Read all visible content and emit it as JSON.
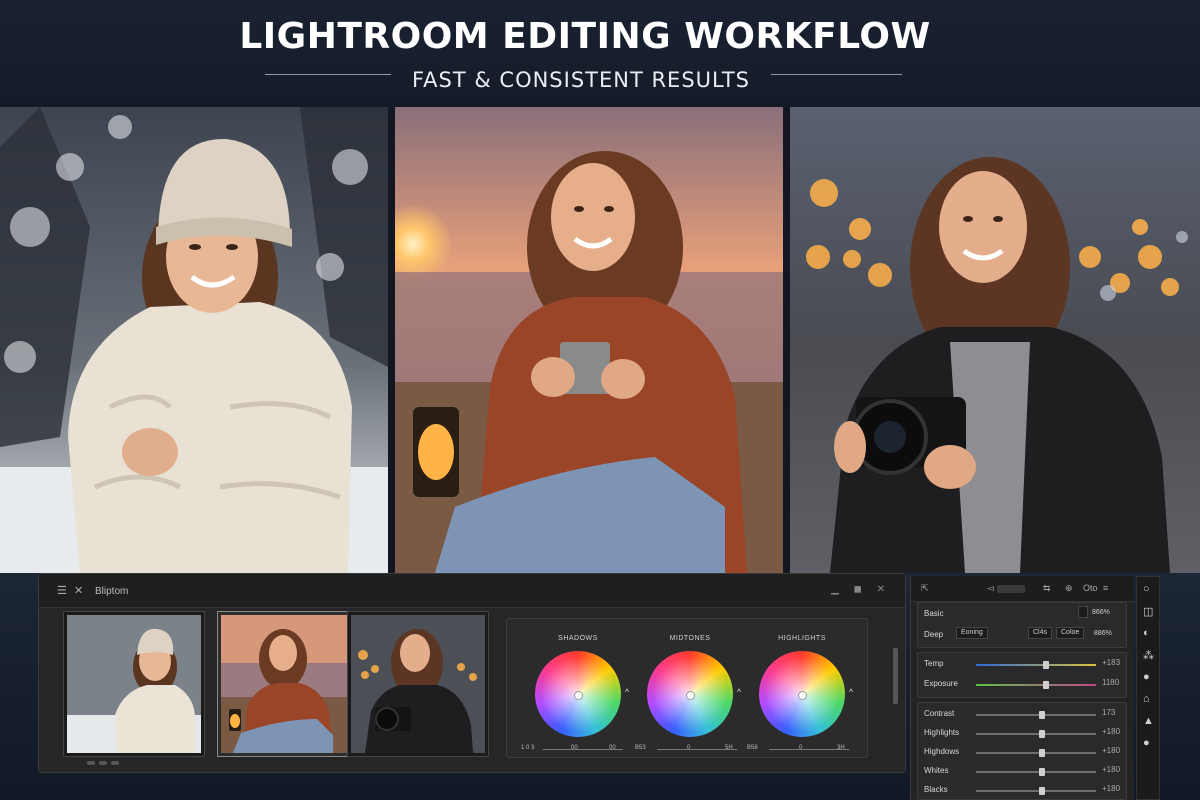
{
  "header": {
    "title": "LIGHTROOM EDITING WORKFLOW",
    "subtitle": "FAST & CONSISTENT RESULTS"
  },
  "photos": [
    {
      "scene": "winter",
      "alt": "Woman in beanie and puffer jacket in snowy forest"
    },
    {
      "scene": "beach-sunset",
      "alt": "Woman holding mug on beach at sunset with lantern"
    },
    {
      "scene": "city-night",
      "alt": "Woman in leather jacket holding camera with city bokeh"
    }
  ],
  "editor": {
    "menu_icon": "☰",
    "close_icon": "✕",
    "name": "Bliptom",
    "window_controls": "▁ ◼ ✕",
    "color_grading": {
      "wheels": [
        {
          "label": "SHADOWS",
          "scale": [
            "1 0 3",
            "00",
            "00"
          ]
        },
        {
          "label": "MIDTONES",
          "scale": [
            "B53",
            "0",
            "5H"
          ]
        },
        {
          "label": "HIGHLIGHTS",
          "scale": [
            "B58",
            "0",
            "3H"
          ]
        }
      ]
    }
  },
  "develop_panel": {
    "top_icons": [
      "⇱",
      "◅",
      "⇆",
      "⊕"
    ],
    "top_label": "Oto",
    "basic": {
      "label": "Basic",
      "value": "866%"
    },
    "row2": {
      "left": "Deep",
      "chip1": "Eoning",
      "chip2": "Cl4s",
      "chip3": "Coloe",
      "value": "886%"
    },
    "tone_sliders": [
      {
        "label": "Temp",
        "value": "+183",
        "position": 0.58,
        "track": "linear-gradient(90deg,#2e6bd6,#d9c23a)"
      },
      {
        "label": "Exposure",
        "value": "1180",
        "position": 0.58,
        "track": "linear-gradient(90deg,#5fbf4a,#c04a8a)"
      }
    ],
    "presence_sliders": [
      {
        "label": "Contrast",
        "value": "173",
        "position": 0.55
      },
      {
        "label": "Highlights",
        "value": "+180",
        "position": 0.55
      },
      {
        "label": "Highdows",
        "value": "+180",
        "position": 0.55
      },
      {
        "label": "Whites",
        "value": "+180",
        "position": 0.55
      },
      {
        "label": "Blacks",
        "value": "+180",
        "position": 0.55
      }
    ]
  },
  "tool_bar_icons": [
    "○",
    "◫",
    "◐",
    "⁂",
    "●",
    "⌂",
    "▲",
    "●"
  ]
}
